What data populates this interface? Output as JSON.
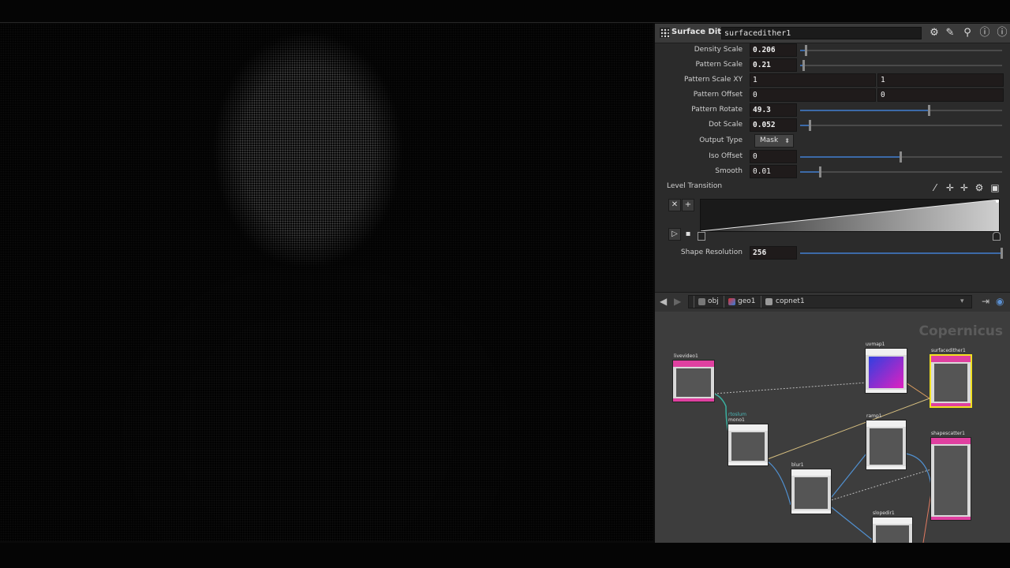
{
  "parm_panel": {
    "node_type": "Surface Dither",
    "node_name": "surfacedither1",
    "header_icons": [
      "gear-icon",
      "brush-icon",
      "search-icon",
      "help-icon",
      "info-icon"
    ],
    "params": {
      "density_scale": {
        "label": "Density Scale",
        "value": "0.206",
        "level": 0.03
      },
      "pattern_scale": {
        "label": "Pattern Scale",
        "value": "0.21",
        "level": 0.02
      },
      "pattern_scale_xy": {
        "label": "Pattern Scale XY",
        "x": "1",
        "y": "1"
      },
      "pattern_offset": {
        "label": "Pattern Offset",
        "x": "0",
        "y": "0"
      },
      "pattern_rotate": {
        "label": "Pattern Rotate",
        "value": "49.3",
        "level": 0.64
      },
      "dot_scale": {
        "label": "Dot Scale",
        "value": "0.052",
        "level": 0.05
      },
      "output_type": {
        "label": "Output Type",
        "value": "Mask"
      },
      "iso_offset": {
        "label": "Iso Offset",
        "value": "0",
        "level": 0.5
      },
      "smooth": {
        "label": "Smooth",
        "value": "0.01",
        "level": 0.1
      },
      "level_transition": {
        "label": "Level Transition"
      },
      "shape_resolution": {
        "label": "Shape Resolution",
        "value": "256",
        "level": 1.0
      }
    }
  },
  "network": {
    "path": [
      "obj",
      "geo1",
      "copnet1"
    ],
    "context_label": "Copernicus",
    "nodes": {
      "livevideo": {
        "name": "livevideo1"
      },
      "mono": {
        "name": "mono1",
        "sub": "rtoslum"
      },
      "uvmap": {
        "name": "uvmap1"
      },
      "surfacedither": {
        "name": "surfacedither1"
      },
      "ramp": {
        "name": "ramp1"
      },
      "blur": {
        "name": "blur1"
      },
      "shapescatter": {
        "name": "shapescatter1"
      },
      "slopedir": {
        "name": "slopedir1"
      }
    }
  },
  "colors": {
    "node_pink": "#e040a0",
    "selected_outline": "#f0e020",
    "slider_fill": "#3c6aa8"
  }
}
